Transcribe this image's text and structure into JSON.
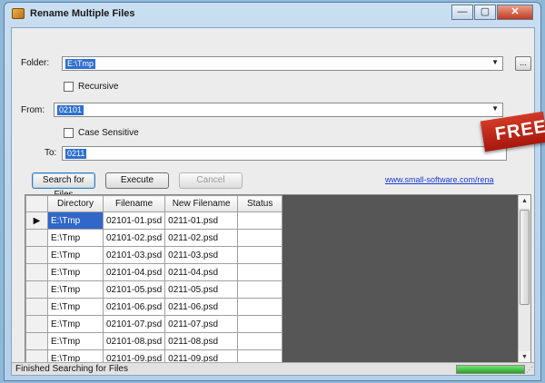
{
  "window": {
    "title": "Rename Multiple Files",
    "icon": "app-icon",
    "controls": {
      "minimize": "—",
      "maximize": "▢",
      "close": "✕"
    }
  },
  "form": {
    "folder_label": "Folder:",
    "folder_value": "E:\\Tmp",
    "browse_label": "...",
    "recursive_label": "Recursive",
    "recursive_checked": false,
    "from_label": "From:",
    "from_value": "02101",
    "case_sensitive_label": "Case Sensitive",
    "case_sensitive_checked": false,
    "to_label": "To:",
    "to_value": "0211"
  },
  "buttons": {
    "search": "Search for Files",
    "execute": "Execute",
    "cancel": "Cancel"
  },
  "link": "www.small-software.com/rena",
  "banner": "FREE",
  "grid": {
    "columns": [
      "Directory",
      "Filename",
      "New Filename",
      "Status"
    ],
    "rows": [
      {
        "dir": "E:\\Tmp",
        "file": "02101-01.psd",
        "new": "0211-01.psd",
        "status": ""
      },
      {
        "dir": "E:\\Tmp",
        "file": "02101-02.psd",
        "new": "0211-02.psd",
        "status": ""
      },
      {
        "dir": "E:\\Tmp",
        "file": "02101-03.psd",
        "new": "0211-03.psd",
        "status": ""
      },
      {
        "dir": "E:\\Tmp",
        "file": "02101-04.psd",
        "new": "0211-04.psd",
        "status": ""
      },
      {
        "dir": "E:\\Tmp",
        "file": "02101-05.psd",
        "new": "0211-05.psd",
        "status": ""
      },
      {
        "dir": "E:\\Tmp",
        "file": "02101-06.psd",
        "new": "0211-06.psd",
        "status": ""
      },
      {
        "dir": "E:\\Tmp",
        "file": "02101-07.psd",
        "new": "0211-07.psd",
        "status": ""
      },
      {
        "dir": "E:\\Tmp",
        "file": "02101-08.psd",
        "new": "0211-08.psd",
        "status": ""
      },
      {
        "dir": "E:\\Tmp",
        "file": "02101-09.psd",
        "new": "0211-09.psd",
        "status": ""
      }
    ],
    "current_row_marker": "▶"
  },
  "status": {
    "message": "Finished Searching for Files",
    "progress": 1.0
  },
  "colors": {
    "selection": "#2f6fd0",
    "progress": "#20a420",
    "banner": "#c42616",
    "link": "#1a3bd0"
  }
}
